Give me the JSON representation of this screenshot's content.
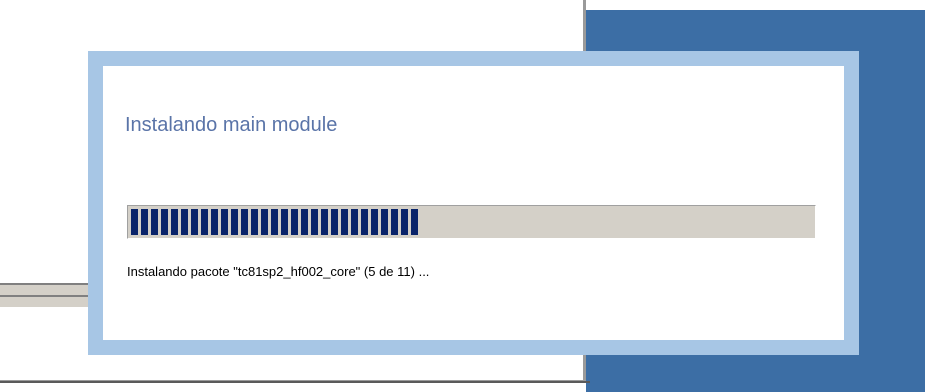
{
  "dialog": {
    "title": "Instalando main module",
    "status": "Instalando pacote \"tc81sp2_hf002_core\" (5 de 11) ...",
    "progress_fraction": 0.42
  },
  "colors": {
    "desktop_blue": "#3c6ea5",
    "frame": "#a7c6e5",
    "title": "#5a74a8",
    "progress_block": "#0a246a",
    "progress_track": "#d4d0c8"
  }
}
